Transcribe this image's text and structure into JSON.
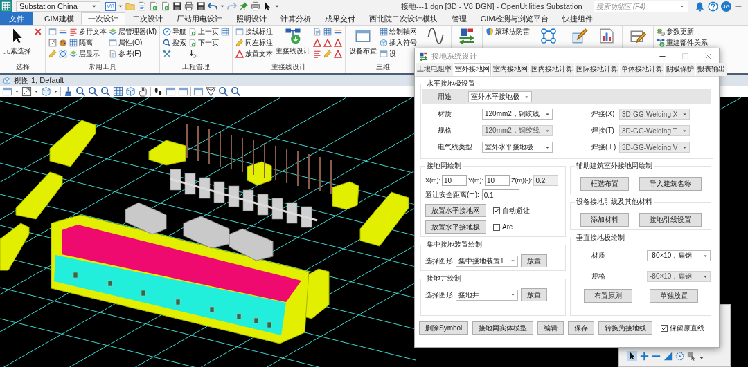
{
  "title_bar": {
    "version_badge": "V8",
    "workspace": "Substation China",
    "title": "接地---1.dgn [3D - V8 DGN] - OpenUtilities Substation",
    "search": {
      "placeholder": "搜索功能区 (F4)"
    },
    "user_initials": "JG"
  },
  "ribbon_tabs": [
    {
      "label": "文件",
      "kind": "file",
      "selected": false
    },
    {
      "label": "GIM建模",
      "kind": "tab",
      "selected": false
    },
    {
      "label": "一次设计",
      "kind": "tab",
      "selected": true
    },
    {
      "label": "二次设计",
      "kind": "tab",
      "selected": false
    },
    {
      "label": "厂站用电设计",
      "kind": "tab",
      "selected": false
    },
    {
      "label": "照明设计",
      "kind": "tab",
      "selected": false
    },
    {
      "label": "计算分析",
      "kind": "tab",
      "selected": false
    },
    {
      "label": "成果交付",
      "kind": "tab",
      "selected": false
    },
    {
      "label": "西北院二次设计模块",
      "kind": "tab",
      "selected": false
    },
    {
      "label": "管理",
      "kind": "tab",
      "selected": false
    },
    {
      "label": "GIM检测与浏览平台",
      "kind": "tab",
      "selected": false
    },
    {
      "label": "快捷组件",
      "kind": "tab",
      "selected": false
    }
  ],
  "ribbon_groups": [
    {
      "label": "选择",
      "items": [
        {
          "kind": "large",
          "label": "元素选择"
        },
        {
          "kind": "icon"
        }
      ]
    },
    {
      "label": "常用工具",
      "items": [
        {
          "kind": "icon"
        },
        {
          "kind": "icon"
        },
        {
          "kind": "icon"
        },
        {
          "kind": "icon"
        },
        {
          "kind": "icon"
        },
        {
          "kind": "icon"
        },
        {
          "kind": "small",
          "label": "多行文本"
        },
        {
          "kind": "small",
          "label": "隔离"
        },
        {
          "kind": "small",
          "label": "层显示"
        },
        {
          "kind": "small",
          "label": "层管理器(M)"
        },
        {
          "kind": "small",
          "label": "属性(O)"
        },
        {
          "kind": "small",
          "label": "参考(F)"
        }
      ]
    },
    {
      "label": "工程管理",
      "items": [
        {
          "kind": "small",
          "label": "导航"
        },
        {
          "kind": "small",
          "label": "搜索"
        },
        {
          "kind": "icon"
        },
        {
          "kind": "small",
          "label": "上一页"
        },
        {
          "kind": "small",
          "label": "下一页"
        },
        {
          "kind": "icon"
        },
        {
          "kind": "icon"
        }
      ]
    },
    {
      "label": "主接线设计",
      "items": [
        {
          "kind": "small",
          "label": "接线标注"
        },
        {
          "kind": "small",
          "label": "同左标注"
        },
        {
          "kind": "small",
          "label": "放置文本"
        },
        {
          "kind": "large",
          "label": "主接线设计"
        },
        {
          "kind": "icon"
        },
        {
          "kind": "icon"
        },
        {
          "kind": "icon"
        },
        {
          "kind": "icon"
        },
        {
          "kind": "icon"
        },
        {
          "kind": "icon"
        },
        {
          "kind": "icon"
        },
        {
          "kind": "icon"
        },
        {
          "kind": "icon"
        }
      ]
    },
    {
      "label": "三维",
      "items": [
        {
          "kind": "large",
          "label": "设备布置"
        },
        {
          "kind": "small",
          "label": "绘制轴网"
        },
        {
          "kind": "small",
          "label": "插入符号"
        },
        {
          "kind": "small",
          "label": "设"
        }
      ]
    },
    {
      "items": [
        {
          "kind": "large-icon"
        }
      ]
    },
    {
      "items": [
        {
          "kind": "large-icon"
        }
      ]
    },
    {
      "items": [
        {
          "kind": "small",
          "label": "滚球法防雷"
        }
      ]
    },
    {
      "items": [
        {
          "kind": "large-icon"
        }
      ]
    },
    {
      "items": [
        {
          "kind": "large-icon"
        },
        {
          "kind": "large-icon"
        }
      ]
    },
    {
      "items": [
        {
          "kind": "large-icon"
        }
      ]
    },
    {
      "items": [
        {
          "kind": "small",
          "label": "参数更新"
        },
        {
          "kind": "small",
          "label": "重建部件关系"
        }
      ]
    }
  ],
  "view": {
    "title": "视图 1, Default"
  },
  "dialog": {
    "title": "接地系统设计",
    "tabs": [
      {
        "label": "土壤电阻率",
        "selected": false
      },
      {
        "label": "室外接地网",
        "selected": true
      },
      {
        "label": "室内接地网",
        "selected": false
      },
      {
        "label": "国内接地计算",
        "selected": false
      },
      {
        "label": "国际接地计算",
        "selected": false
      },
      {
        "label": "单体接地计算",
        "selected": false
      },
      {
        "label": "阴极保护",
        "selected": false
      },
      {
        "label": "报表输出",
        "selected": false
      }
    ],
    "horizontal": {
      "title": "水平接地极设置",
      "usage": {
        "label": "用途",
        "value": "室外水平接地极",
        "disabled": false
      },
      "fields": [
        {
          "label": "材质",
          "value": "120mm2，铜绞线",
          "disabled": false
        },
        {
          "label": "焊接(X)",
          "value": "3D-GG-Welding X",
          "disabled": true
        },
        {
          "label": "规格",
          "value": "120mm2，铜绞线",
          "disabled": true
        },
        {
          "label": "焊接(T)",
          "value": "3D-GG-Welding T",
          "disabled": true
        },
        {
          "label": "电气线类型",
          "value": "室外水平接地极",
          "disabled": false
        },
        {
          "label": "焊接(⊥)",
          "value": "3D-GG-Welding V",
          "disabled": true
        }
      ]
    },
    "left_sections": [
      {
        "kind": "grid",
        "title": "接地网绘制",
        "coords": [
          {
            "label": "X(m):",
            "value": "10",
            "disabled": false
          },
          {
            "label": "Y(m):",
            "value": "10",
            "disabled": false
          },
          {
            "label": "Z(m)(-):",
            "value": "0.2",
            "disabled": true
          }
        ],
        "clearance": {
          "label": "避让安全距离(m):",
          "value": "0.1"
        },
        "actions": [
          {
            "button": "放置水平接地网",
            "option": {
              "label": "自动避让",
              "checked": true
            }
          },
          {
            "button": "放置水平接地极",
            "option": {
              "label": "Arc",
              "checked": false
            }
          }
        ]
      },
      {
        "kind": "picker",
        "title": "集中接地装置绘制",
        "label": "选择图形",
        "value": "集中接地装置1",
        "button": "放置"
      },
      {
        "kind": "picker",
        "title": "接地井绘制",
        "label": "选择图形",
        "value": "接地井",
        "button": "放置"
      }
    ],
    "right_sections": [
      {
        "kind": "buttons",
        "title": "辅助建筑室外接地网绘制",
        "buttons": [
          "框选布置",
          "导入建筑名称"
        ]
      },
      {
        "kind": "buttons",
        "title": "设备接地引线及其他材料",
        "buttons": [
          "添加材料",
          "接地引线设置"
        ]
      },
      {
        "kind": "vertical",
        "title": "垂直接地极绘制",
        "fields": [
          {
            "label": "材质",
            "value": "-80×10，扁钢",
            "disabled": false
          },
          {
            "label": "规格",
            "value": "-80×10，扁钢",
            "disabled": true
          }
        ],
        "buttons": [
          "布置原则",
          "单独放置"
        ]
      }
    ],
    "footer": {
      "buttons": [
        "删除Symbol",
        "接地网实体模型",
        "编辑",
        "保存",
        "转换为接地线"
      ],
      "option": {
        "label": "保留原直线",
        "checked": true
      }
    }
  }
}
